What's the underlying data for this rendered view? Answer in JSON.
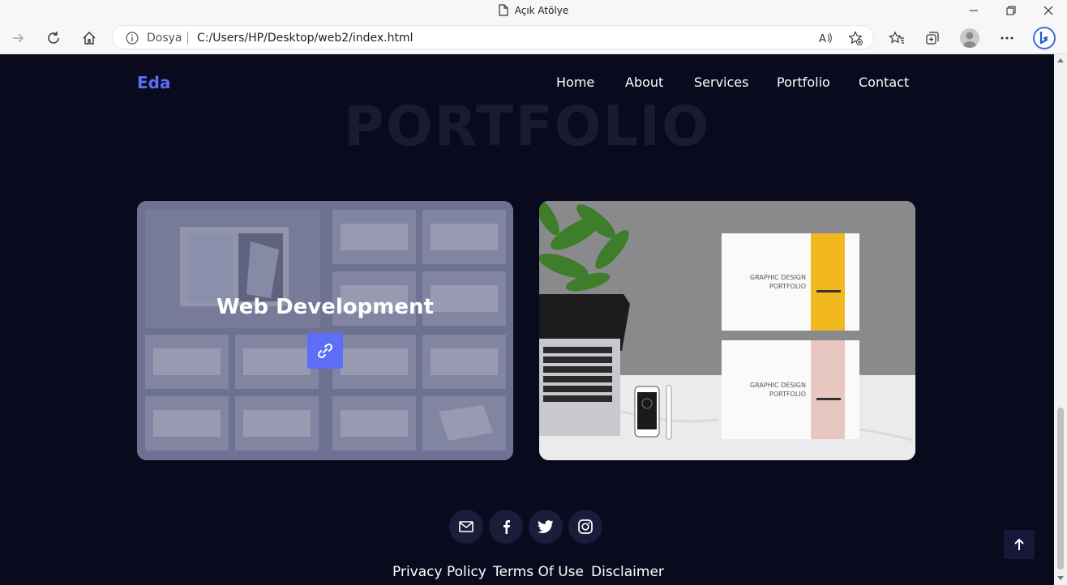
{
  "window": {
    "title": "Açık Atölye"
  },
  "address": {
    "security_label": "Dosya",
    "url": "C:/Users/HP/Desktop/web2/index.html"
  },
  "icons": {
    "page": "page-icon",
    "minimize": "minimize-icon",
    "restore": "restore-icon",
    "close": "close-icon",
    "forward": "forward-icon",
    "refresh": "refresh-icon",
    "home": "home-icon",
    "info": "info-icon",
    "read_aloud": "read-aloud-icon",
    "add_favorite": "add-favorite-icon",
    "favorites": "favorites-icon",
    "collections": "collections-icon",
    "profile": "profile-avatar",
    "menu": "more-menu-icon",
    "bing": "bing-icon"
  },
  "site": {
    "logo": "Eda",
    "nav": [
      "Home",
      "About",
      "Services",
      "Portfolio",
      "Contact"
    ],
    "section_bg_title": "PORTFOLIO",
    "cards": [
      {
        "title": "Web Development",
        "image": "portfolio-brochure-grid-image"
      },
      {
        "image": "graphic-design-desk-image",
        "book1_line1": "GRAPHIC DESIGN",
        "book1_line2": "PORTFOLIO",
        "book2_line1": "GRAPHIC DESIGN",
        "book2_line2": "PORTFOLIO"
      }
    ],
    "social": [
      "mail-icon",
      "facebook-icon",
      "twitter-icon",
      "instagram-icon"
    ],
    "footer_links": [
      "Privacy Policy",
      "Terms Of Use",
      "Disclaimer"
    ]
  },
  "colors": {
    "page_bg": "#0a0a1f",
    "accent": "#5b6ef5",
    "social_bg": "#1c1c3a"
  }
}
